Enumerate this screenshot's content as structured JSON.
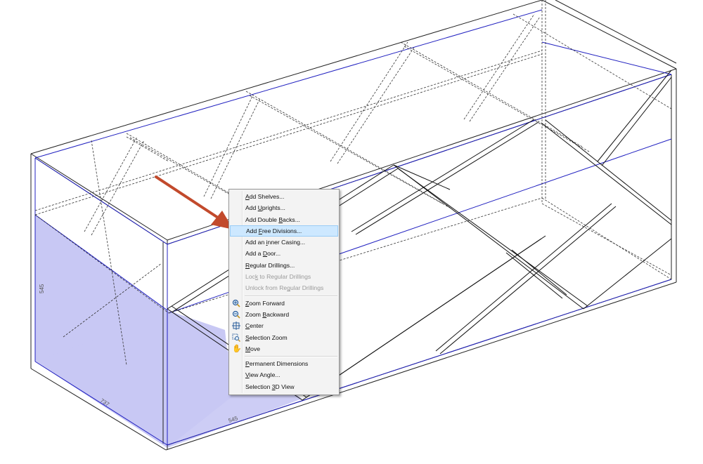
{
  "dimensions": {
    "height_label": "545",
    "depth_label": "737",
    "width_label": "545"
  },
  "context_menu": {
    "items": [
      {
        "pre": "",
        "u": "A",
        "post": "dd Shelves...",
        "disabled": false
      },
      {
        "pre": "Add ",
        "u": "U",
        "post": "prights...",
        "disabled": false
      },
      {
        "pre": "Add Double ",
        "u": "B",
        "post": "acks...",
        "disabled": false
      },
      {
        "pre": "Add ",
        "u": "F",
        "post": "ree Divisions...",
        "disabled": false,
        "highlighted": true
      },
      {
        "pre": "Add an ",
        "u": "i",
        "post": "nner Casing...",
        "disabled": false
      },
      {
        "pre": "Add a ",
        "u": "D",
        "post": "oor...",
        "disabled": false
      },
      {
        "pre": "",
        "u": "R",
        "post": "egular Drillings...",
        "disabled": false
      },
      {
        "pre": "Loc",
        "u": "k",
        "post": " to Regular Drillings",
        "disabled": true
      },
      {
        "pre": "Unlock from Re",
        "u": "g",
        "post": "ular Drillings",
        "disabled": true
      },
      {
        "pre": "",
        "u": "Z",
        "post": "oom Forward",
        "icon": "zoom-in-icon"
      },
      {
        "pre": "Zoom ",
        "u": "B",
        "post": "ackward",
        "icon": "zoom-out-icon"
      },
      {
        "pre": "",
        "u": "C",
        "post": "enter",
        "icon": "center-icon"
      },
      {
        "pre": "",
        "u": "S",
        "post": "election Zoom",
        "icon": "selection-zoom-icon"
      },
      {
        "pre": "",
        "u": "M",
        "post": "ove",
        "icon": "hand-icon"
      },
      {
        "pre": "",
        "u": "P",
        "post": "ermanent Dimensions"
      },
      {
        "pre": "",
        "u": "V",
        "post": "iew Angle..."
      },
      {
        "pre": "Selection ",
        "u": "3",
        "post": "D View"
      }
    ]
  },
  "colors": {
    "highlight_fill": "#cde8ff",
    "selected_panel": "#c8c8f4",
    "arrow": "#c24a2c",
    "edge_blue": "#2020c0"
  }
}
